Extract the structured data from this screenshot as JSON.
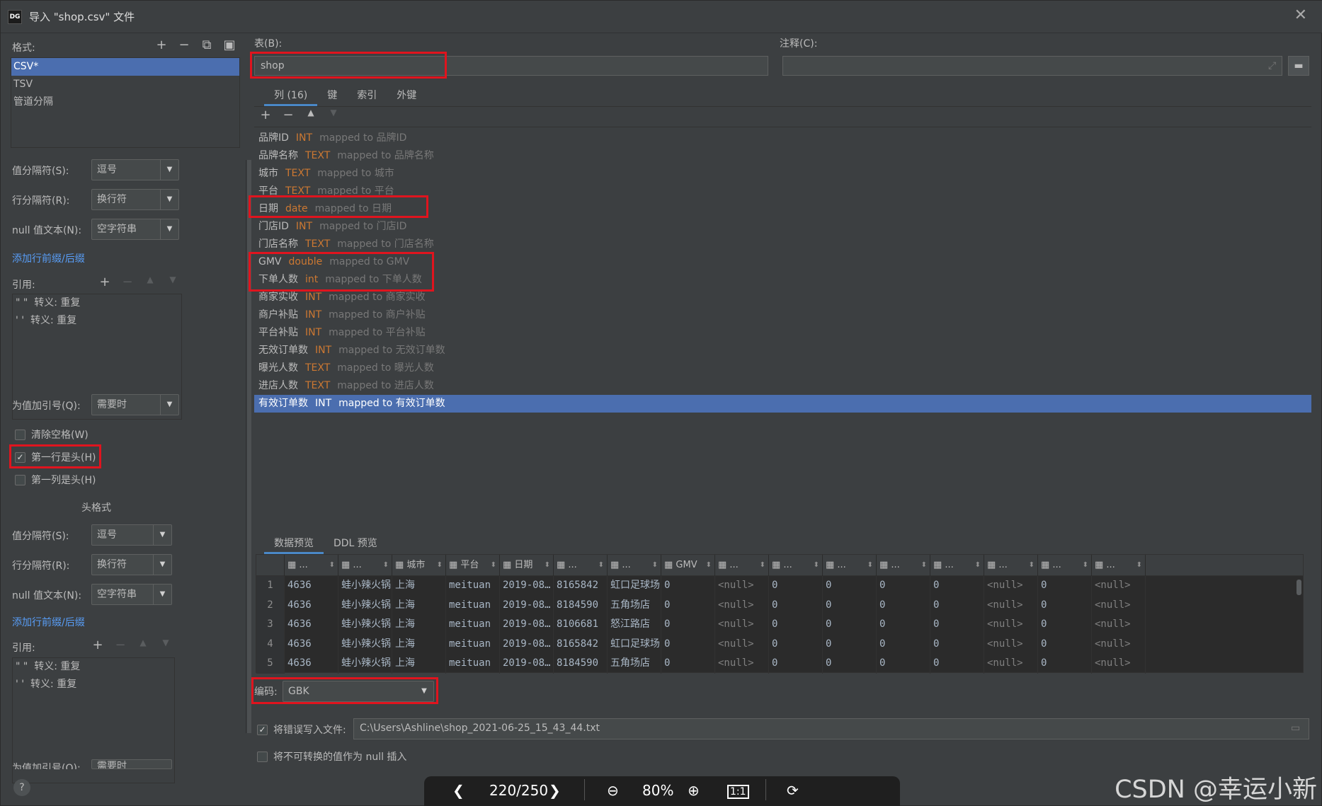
{
  "window": {
    "title": "导入 \"shop.csv\" 文件",
    "app_icon_text": "DG"
  },
  "left": {
    "format_label": "格式:",
    "formats": [
      "CSV*",
      "TSV",
      "管道分隔"
    ],
    "value_sep_label": "值分隔符(S):",
    "value_sep_value": "逗号",
    "row_sep_label": "行分隔符(R):",
    "row_sep_value": "换行符",
    "null_text_label": "null 值文本(N):",
    "null_text_value": "空字符串",
    "add_prefix_link": "添加行前缀/后缀",
    "quote_label": "引用:",
    "quotes": [
      "\" \"  转义: 重复",
      "' '  转义: 重复"
    ],
    "quote_values_label": "为值加引号(Q):",
    "quote_values_value": "需要时",
    "trim_label": "清除空格(W)",
    "first_row_header_label": "第一行是头(H)",
    "first_row_header_checked": true,
    "first_col_header_label": "第一列是头(H)",
    "header_format_title": "头格式",
    "h_value_sep_label": "值分隔符(S):",
    "h_value_sep_value": "逗号",
    "h_row_sep_label": "行分隔符(R):",
    "h_row_sep_value": "换行符",
    "h_null_text_label": "null 值文本(N):",
    "h_null_text_value": "空字符串",
    "h_add_prefix_link": "添加行前缀/后缀",
    "h_quote_label": "引用:",
    "h_quotes": [
      "\" \"  转义: 重复",
      "' '  转义: 重复"
    ],
    "h_quote_values_label": "为值加引号(Q):",
    "h_quote_values_value": "需要时"
  },
  "right": {
    "table_label": "表(B):",
    "table_value": "shop",
    "comment_label": "注释(C):",
    "comment_value": "",
    "tabs": [
      "列 (16)",
      "键",
      "索引",
      "外键"
    ],
    "columns": [
      {
        "name": "品牌ID",
        "type": "INT",
        "map": "mapped to 品牌ID"
      },
      {
        "name": "品牌名称",
        "type": "TEXT",
        "map": "mapped to 品牌名称"
      },
      {
        "name": "城市",
        "type": "TEXT",
        "map": "mapped to 城市"
      },
      {
        "name": "平台",
        "type": "TEXT",
        "map": "mapped to 平台"
      },
      {
        "name": "日期",
        "type": "date",
        "map": "mapped to 日期"
      },
      {
        "name": "门店ID",
        "type": "INT",
        "map": "mapped to 门店ID"
      },
      {
        "name": "门店名称",
        "type": "TEXT",
        "map": "mapped to 门店名称"
      },
      {
        "name": "GMV",
        "type": "double",
        "map": "mapped to GMV"
      },
      {
        "name": "下单人数",
        "type": "int",
        "map": "mapped to 下单人数"
      },
      {
        "name": "商家实收",
        "type": "INT",
        "map": "mapped to 商家实收"
      },
      {
        "name": "商户补贴",
        "type": "INT",
        "map": "mapped to 商户补贴"
      },
      {
        "name": "平台补贴",
        "type": "INT",
        "map": "mapped to 平台补贴"
      },
      {
        "name": "无效订单数",
        "type": "INT",
        "map": "mapped to 无效订单数"
      },
      {
        "name": "曝光人数",
        "type": "TEXT",
        "map": "mapped to 曝光人数"
      },
      {
        "name": "进店人数",
        "type": "TEXT",
        "map": "mapped to 进店人数"
      },
      {
        "name": "有效订单数",
        "type": "INT",
        "map": "mapped to 有效订单数"
      }
    ],
    "preview_tabs": [
      "数据预览",
      "DDL 预览"
    ],
    "preview_headers": [
      "...",
      "...",
      "城市",
      "平台",
      "日期",
      "...",
      "...",
      "GMV",
      "...",
      "...",
      "...",
      "...",
      "...",
      "...",
      "...",
      "..."
    ],
    "preview_rows": [
      [
        "1",
        "4636",
        "蛙小辣火锅",
        "上海",
        "meituan",
        "2019-08…",
        "8165842",
        "虹口足球场",
        "0",
        "<null>",
        "0",
        "0",
        "0",
        "0",
        "<null>",
        "0",
        "<null>"
      ],
      [
        "2",
        "4636",
        "蛙小辣火锅",
        "上海",
        "meituan",
        "2019-08…",
        "8184590",
        "五角场店",
        "0",
        "<null>",
        "0",
        "0",
        "0",
        "0",
        "<null>",
        "0",
        "<null>"
      ],
      [
        "3",
        "4636",
        "蛙小辣火锅",
        "上海",
        "meituan",
        "2019-08…",
        "8106681",
        "怒江路店",
        "0",
        "<null>",
        "0",
        "0",
        "0",
        "0",
        "<null>",
        "0",
        "<null>"
      ],
      [
        "4",
        "4636",
        "蛙小辣火锅",
        "上海",
        "meituan",
        "2019-08…",
        "8165842",
        "虹口足球场",
        "0",
        "<null>",
        "0",
        "0",
        "0",
        "0",
        "<null>",
        "0",
        "<null>"
      ],
      [
        "5",
        "4636",
        "蛙小辣火锅",
        "上海",
        "meituan",
        "2019-08…",
        "8184590",
        "五角场店",
        "0",
        "<null>",
        "0",
        "0",
        "0",
        "0",
        "<null>",
        "0",
        "<null>"
      ]
    ],
    "encoding_label": "编码:",
    "encoding_value": "GBK",
    "write_errors_label": "将错误写入文件:",
    "write_errors_checked": true,
    "error_file_path": "C:\\Users\\Ashline\\shop_2021-06-25_15_43_44.txt",
    "null_insert_label": "将不可转换的值作为 null 插入"
  },
  "viewer": {
    "page": "220/250",
    "zoom": "80%",
    "one_to_one": "1:1"
  },
  "watermark": "CSDN @幸运小新",
  "colors": {
    "selection": "#4b6eaf",
    "type_orange": "#cc7832",
    "highlight_red": "#e0141e",
    "link_blue": "#589df6"
  }
}
